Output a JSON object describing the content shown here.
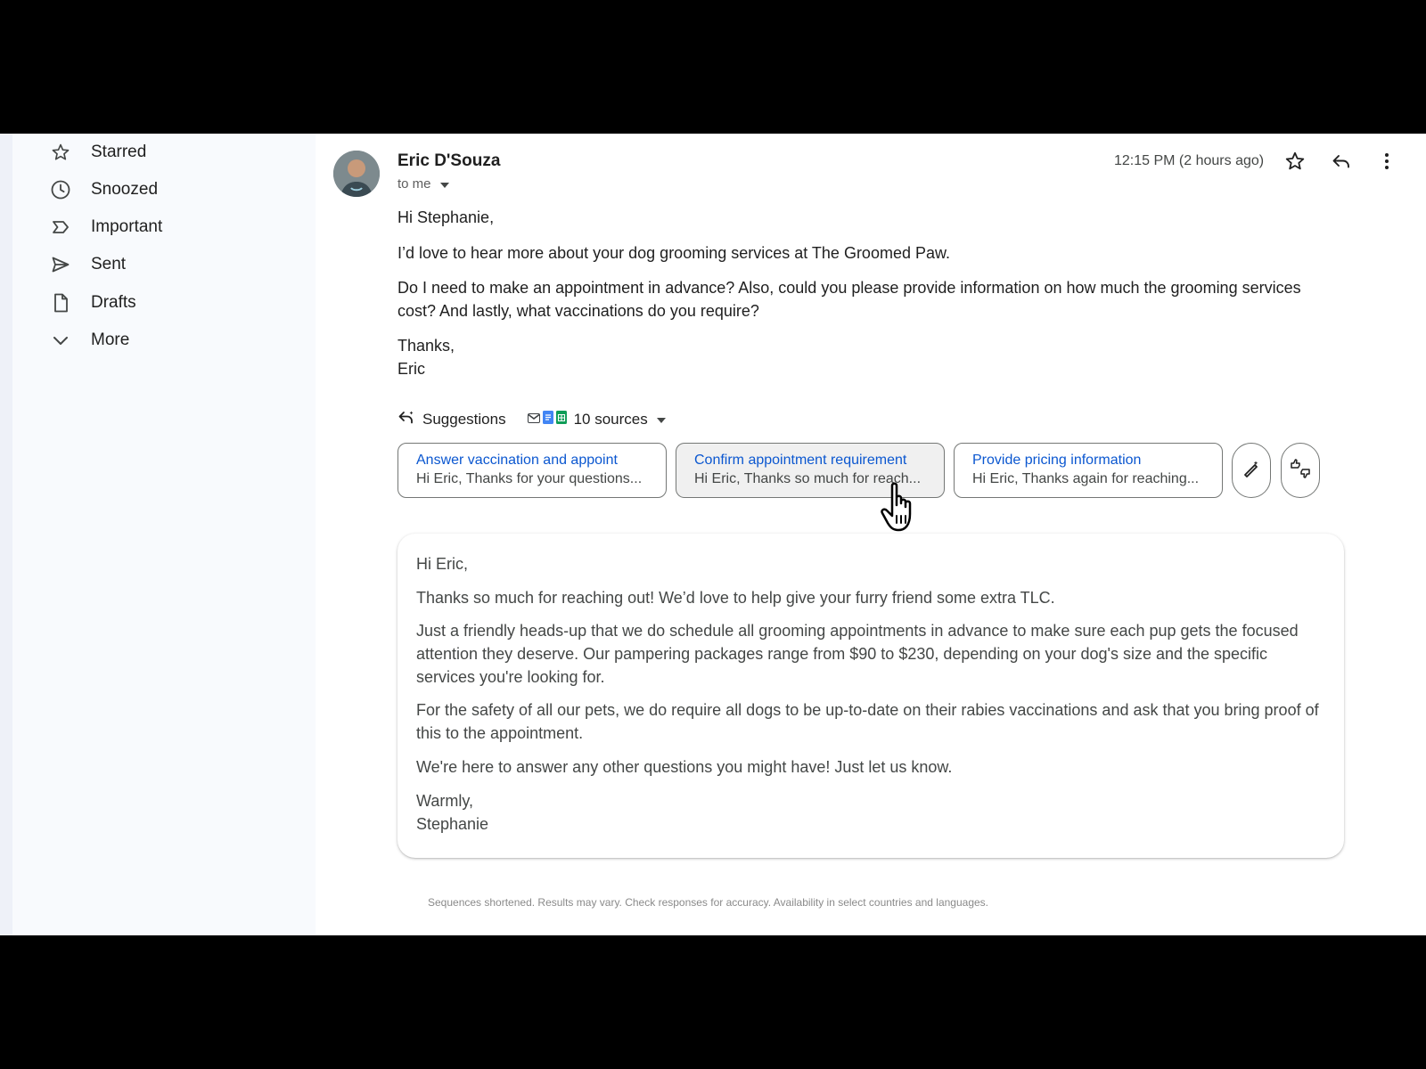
{
  "sidebar": {
    "items": [
      {
        "label": "Starred",
        "icon": "star-icon"
      },
      {
        "label": "Snoozed",
        "icon": "clock-icon"
      },
      {
        "label": "Important",
        "icon": "important-icon"
      },
      {
        "label": "Sent",
        "icon": "send-icon"
      },
      {
        "label": "Drafts",
        "icon": "draft-icon"
      },
      {
        "label": "More",
        "icon": "chevron-down-icon"
      }
    ]
  },
  "email": {
    "sender": "Eric D'Souza",
    "recipient": "to me",
    "timestamp": "12:15 PM (2 hours ago)",
    "greeting": "Hi Stephanie,",
    "paragraphs": [
      "I’d love to hear more about your dog grooming services at The Groomed Paw.",
      "Do I need to make an appointment in advance? Also, could you please provide information on how much the grooming services cost? And lastly, what vaccinations do you require?"
    ],
    "closing": "Thanks,",
    "signature": "Eric"
  },
  "suggestions": {
    "label": "Suggestions",
    "sources_label": "10 sources",
    "chips": [
      {
        "title": "Answer vaccination and appoint",
        "snippet": "Hi Eric, Thanks for your questions..."
      },
      {
        "title": "Confirm appointment requirement",
        "snippet": "Hi Eric, Thanks so much for reach..."
      },
      {
        "title": "Provide pricing information",
        "snippet": "Hi Eric, Thanks again for reaching..."
      }
    ]
  },
  "draft": {
    "greeting": "Hi Eric,",
    "paragraphs": [
      "Thanks so much for reaching out! We’d love to help give your furry friend some extra TLC.",
      "Just a friendly heads-up that we do schedule all grooming appointments in advance to make sure each pup gets the focused attention they deserve. Our pampering packages range from $90 to $230, depending on your dog's size and the specific services you're looking for.",
      "For the safety of all our pets, we do require all dogs to be up-to-date on their rabies vaccinations and ask that you bring proof of this to the appointment.",
      "We're here to answer any other questions you might have! Just let us know."
    ],
    "closing": "Warmly,",
    "signature": "Stephanie"
  },
  "disclaimer": "Sequences shortened. Results may vary. Check responses for accuracy. Availability in select countries and languages.",
  "colors": {
    "link_blue": "#0b57d0",
    "sidebar_bg": "#f8fafd",
    "gmail_red": "#ea4335",
    "docs_blue": "#4285f4",
    "sheets_green": "#0f9d58"
  }
}
